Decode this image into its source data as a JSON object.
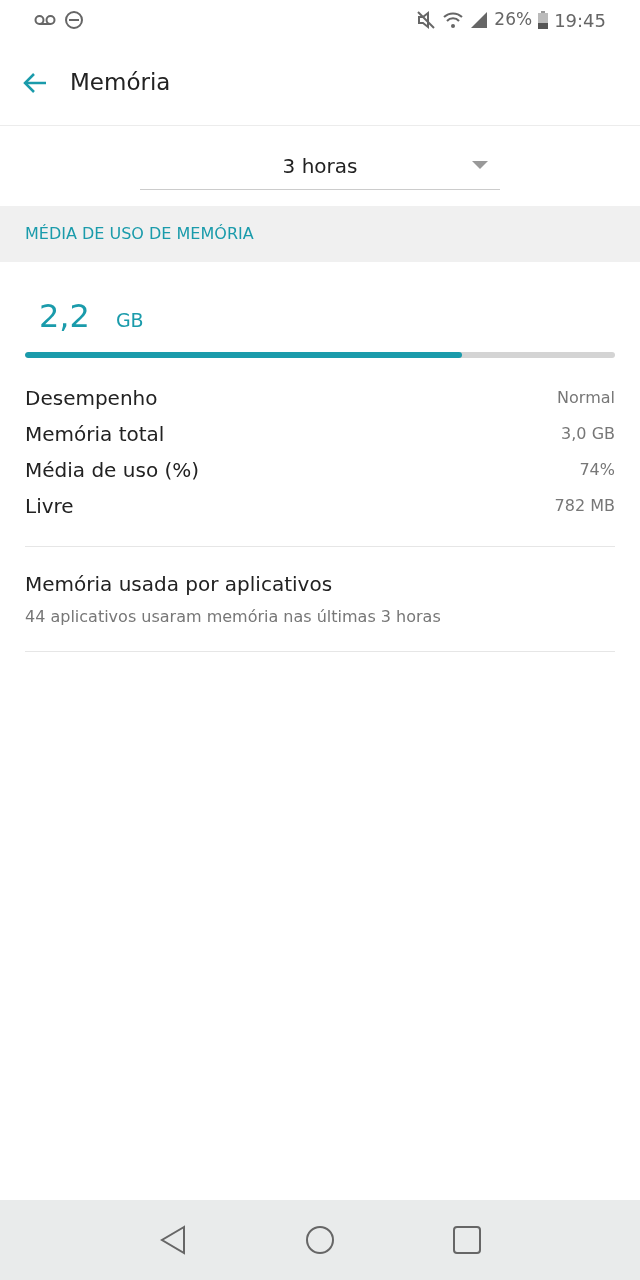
{
  "status_bar": {
    "battery_text": "26%",
    "time": "19:45"
  },
  "header": {
    "title": "Memória"
  },
  "period_dropdown": {
    "value": "3 horas"
  },
  "section": {
    "title": "MÉDIA DE USO DE MEMÓRIA"
  },
  "usage": {
    "value": "2,2",
    "unit": "GB",
    "level": 0.74
  },
  "stats": [
    {
      "label": "Desempenho",
      "value": "Normal"
    },
    {
      "label": "Memória total",
      "value": "3,0 GB"
    },
    {
      "label": "Média de uso (%)",
      "value": "74%"
    },
    {
      "label": "Livre",
      "value": "782 MB"
    }
  ],
  "apps_item": {
    "title": "Memória usada por aplicativos",
    "subtitle": "44 aplicativos usaram memória nas últimas 3 horas"
  }
}
